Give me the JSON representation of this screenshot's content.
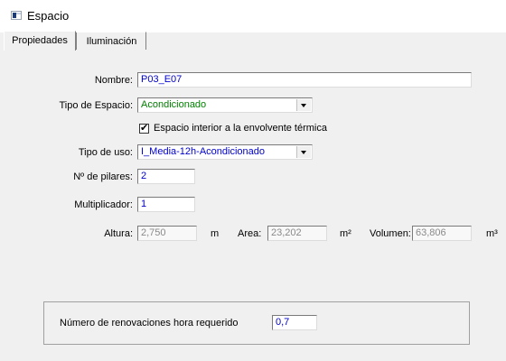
{
  "window": {
    "title": "Espacio"
  },
  "tabs": [
    {
      "label": "Propiedades"
    },
    {
      "label": "Iluminación"
    }
  ],
  "form": {
    "nombre": {
      "label": "Nombre:",
      "value": "P03_E07"
    },
    "tipo_espacio": {
      "label": "Tipo de Espacio:",
      "value": "Acondicionado",
      "color": "#008000"
    },
    "interior_envolvente": {
      "label": "Espacio interior a la envolvente térmica",
      "checked": true
    },
    "tipo_uso": {
      "label": "Tipo de uso:",
      "value": "I_Media-12h-Acondicionado"
    },
    "pilares": {
      "label": "Nº de pilares:",
      "value": "2"
    },
    "multiplicador": {
      "label": "Multiplicador:",
      "value": "1"
    },
    "altura": {
      "label": "Altura:",
      "value": "2,750",
      "unit": "m"
    },
    "area": {
      "label": "Area:",
      "value": "23,202",
      "unit": "m²"
    },
    "volumen": {
      "label": "Volumen:",
      "value": "63,806",
      "unit": "m³"
    }
  },
  "renovaciones": {
    "label": "Número de renovaciones hora requerido",
    "value": "0,7"
  },
  "icons": {
    "app": "app-window-icon",
    "check": "check-icon",
    "dropdown": "chevron-down-icon"
  }
}
